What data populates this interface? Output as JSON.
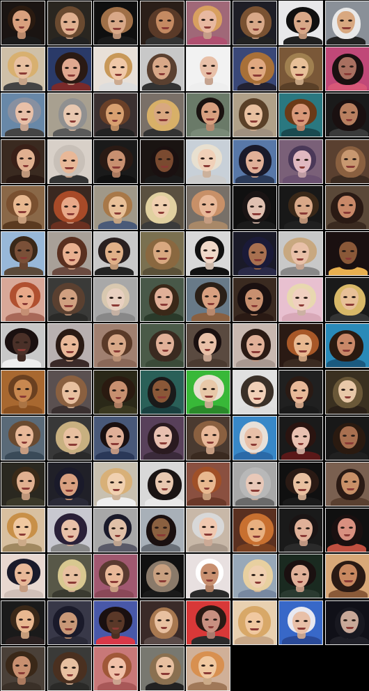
{
  "grid": {
    "columns": 8,
    "tiles": [
      {
        "bg": "#1a1412",
        "skin": "#d9a07e",
        "hair": "#2a1a10",
        "cloth": "#1a1a1a"
      },
      {
        "bg": "#2a2620",
        "skin": "#e0b090",
        "hair": "#6a4a30",
        "cloth": "#222"
      },
      {
        "bg": "#0f0f0f",
        "skin": "#d8a888",
        "hair": "#a07048",
        "cloth": "#1a1a1a"
      },
      {
        "bg": "#2a1e18",
        "skin": "#c48a62",
        "hair": "#5a3a28",
        "cloth": "#333"
      },
      {
        "bg": "#a06878",
        "skin": "#e8b8a0",
        "hair": "#d8a060",
        "cloth": "#b05070"
      },
      {
        "bg": "#1e1e26",
        "skin": "#d8a888",
        "hair": "#7a5232",
        "cloth": "#222"
      },
      {
        "bg": "#e8e8ea",
        "skin": "#d8a888",
        "hair": "#101010",
        "cloth": "#202020"
      },
      {
        "bg": "#8a9098",
        "skin": "#d8a880",
        "hair": "#e8e8e8",
        "cloth": "#222"
      },
      {
        "bg": "#cfc0a8",
        "skin": "#e8c0a0",
        "hair": "#d8b070",
        "cloth": "#444"
      },
      {
        "bg": "#2a3a68",
        "skin": "#e0a890",
        "hair": "#2a1a14",
        "cloth": "#7a2a2a"
      },
      {
        "bg": "#e8e0d8",
        "skin": "#f0c8a8",
        "hair": "#c89858",
        "cloth": "#ddd"
      },
      {
        "bg": "#c8c8c8",
        "skin": "#d8a888",
        "hair": "#5a4030",
        "cloth": "#333"
      },
      {
        "bg": "#f2f2f2",
        "skin": "#e8c0a8",
        "hair": "#f2f2f2",
        "cloth": "#eee"
      },
      {
        "bg": "#3a4878",
        "skin": "#e0a880",
        "hair": "#a87038",
        "cloth": "#223"
      },
      {
        "bg": "#7a5838",
        "skin": "#e8c098",
        "hair": "#a08050",
        "cloth": "#5a4028"
      },
      {
        "bg": "#c04878",
        "skin": "#a87060",
        "hair": "#1a1010",
        "cloth": "#d85878"
      },
      {
        "bg": "#6888a8",
        "skin": "#e8c0a8",
        "hair": "#8890a0",
        "cloth": "#444"
      },
      {
        "bg": "#a8a090",
        "skin": "#e8c8b0",
        "hair": "#909090",
        "cloth": "#5a5a5a"
      },
      {
        "bg": "#3a3030",
        "skin": "#d8a070",
        "hair": "#6a4028",
        "cloth": "#222"
      },
      {
        "bg": "#7a7068",
        "skin": "#d8a880",
        "hair": "#d8b068",
        "cloth": "#333"
      },
      {
        "bg": "#6a7a68",
        "skin": "#d8a080",
        "hair": "#1a1210",
        "cloth": "#7a8a78"
      },
      {
        "bg": "#b0a088",
        "skin": "#e8c0a0",
        "hair": "#5a4028",
        "cloth": "#a09080"
      },
      {
        "bg": "#2a7880",
        "skin": "#d89878",
        "hair": "#6a3a18",
        "cloth": "#1a4a50"
      },
      {
        "bg": "#1a1a1a",
        "skin": "#b88060",
        "hair": "#1a1010",
        "cloth": "#3a3a3a"
      },
      {
        "bg": "#3a2a20",
        "skin": "#e0b090",
        "hair": "#3a2018",
        "cloth": "#2a1a14"
      },
      {
        "bg": "#d8d0c8",
        "skin": "#e8b898",
        "hair": "#c8c0b8",
        "cloth": "#333"
      },
      {
        "bg": "#1a1a1a",
        "skin": "#c89070",
        "hair": "#2a1a14",
        "cloth": "#101010"
      },
      {
        "bg": "#1a1412",
        "skin": "#7a4a30",
        "hair": "#1a1010",
        "cloth": "#1a1a1a"
      },
      {
        "bg": "#c8d0d8",
        "skin": "#f0d0b8",
        "hair": "#e8e0d0",
        "cloth": "#ccc"
      },
      {
        "bg": "#5878a8",
        "skin": "#e0b098",
        "hair": "#1a1a2a",
        "cloth": "#2a3a58"
      },
      {
        "bg": "#7a6078",
        "skin": "#e0b8c0",
        "hair": "#4a3858",
        "cloth": "#6a5070"
      },
      {
        "bg": "#5a4030",
        "skin": "#c89870",
        "hair": "#8a6040",
        "cloth": "#3a2a20"
      },
      {
        "bg": "#8a6848",
        "skin": "#e8b890",
        "hair": "#7a5030",
        "cloth": "#5a3a20"
      },
      {
        "bg": "#3a2820",
        "skin": "#e8a888",
        "hair": "#a84a28",
        "cloth": "#6a3020"
      },
      {
        "bg": "#a09888",
        "skin": "#e8c098",
        "hair": "#a87848",
        "cloth": "#4a5a78"
      },
      {
        "bg": "#5a5040",
        "skin": "#f0d0b0",
        "hair": "#e0d0a0",
        "cloth": "#3a3a3a"
      },
      {
        "bg": "#787068",
        "skin": "#e8b898",
        "hair": "#c89068",
        "cloth": "#a88868"
      },
      {
        "bg": "#101010",
        "skin": "#e0c0b0",
        "hair": "#1a1414",
        "cloth": "#1a1a1a"
      },
      {
        "bg": "#181818",
        "skin": "#d8a888",
        "hair": "#3a2818",
        "cloth": "#202020"
      },
      {
        "bg": "#5a4838",
        "skin": "#c88868",
        "hair": "#2a1a14",
        "cloth": "#3a2a20"
      },
      {
        "bg": "#98b8d8",
        "skin": "#7a5038",
        "hair": "#3a2818",
        "cloth": "#5a4a3a"
      },
      {
        "bg": "#a8a098",
        "skin": "#e8b090",
        "hair": "#5a3020",
        "cloth": "#6a4a40"
      },
      {
        "bg": "#c8c8c8",
        "skin": "#e0b088",
        "hair": "#2a2020",
        "cloth": "#222"
      },
      {
        "bg": "#7a7050",
        "skin": "#d8a880",
        "hair": "#8a6840",
        "cloth": "#5a5038"
      },
      {
        "bg": "#d8d8d8",
        "skin": "#f0d8c8",
        "hair": "#101010",
        "cloth": "#111"
      },
      {
        "bg": "#1a1a28",
        "skin": "#a87050",
        "hair": "#1a1a38",
        "cloth": "#2a2a48"
      },
      {
        "bg": "#c8c8c8",
        "skin": "#e8c0a8",
        "hair": "#c8a880",
        "cloth": "#888"
      },
      {
        "bg": "#1a1010",
        "skin": "#8a5838",
        "hair": "#1a1010",
        "cloth": "#e8b050"
      },
      {
        "bg": "#d8a898",
        "skin": "#e8a888",
        "hair": "#b05030",
        "cloth": "#a86858"
      },
      {
        "bg": "#3a3a38",
        "skin": "#d0a080",
        "hair": "#5a4030",
        "cloth": "#2a2a28"
      },
      {
        "bg": "#a8a8a8",
        "skin": "#e8d0c0",
        "hair": "#d8c8b0",
        "cloth": "#888"
      },
      {
        "bg": "#485848",
        "skin": "#e0b098",
        "hair": "#3a2818",
        "cloth": "#2a3a2a"
      },
      {
        "bg": "#687a88",
        "skin": "#d8a080",
        "hair": "#2a2018",
        "cloth": "#8a6040"
      },
      {
        "bg": "#3a2a20",
        "skin": "#c89070",
        "hair": "#1a1010",
        "cloth": "#2a1a14"
      },
      {
        "bg": "#e8c0d0",
        "skin": "#f0d0c0",
        "hair": "#e8d8b0",
        "cloth": "#d8a8b8"
      },
      {
        "bg": "#1a1a1a",
        "skin": "#e8c098",
        "hair": "#d8b868",
        "cloth": "#333"
      },
      {
        "bg": "#c8c8c8",
        "skin": "#4a3028",
        "hair": "#1a1010",
        "cloth": "#eee"
      },
      {
        "bg": "#b8b0b0",
        "skin": "#e8b898",
        "hair": "#2a1a14",
        "cloth": "#3a2a28"
      },
      {
        "bg": "#a08070",
        "skin": "#d8a888",
        "hair": "#5a3a28",
        "cloth": "#8a6858"
      },
      {
        "bg": "#4a5a48",
        "skin": "#e0b098",
        "hair": "#3a2a20",
        "cloth": "#3a4a38"
      },
      {
        "bg": "#5a4a40",
        "skin": "#e8c0a8",
        "hair": "#1a1010",
        "cloth": "#4a3a30"
      },
      {
        "bg": "#c8b8b0",
        "skin": "#e0b098",
        "hair": "#2a1a14",
        "cloth": "#a89890"
      },
      {
        "bg": "#2a1a14",
        "skin": "#e8b890",
        "hair": "#a85828",
        "cloth": "#3a2a20"
      },
      {
        "bg": "#2a8ab8",
        "skin": "#c88868",
        "hair": "#2a1a10",
        "cloth": "#1a5a80"
      },
      {
        "bg": "#a86830",
        "skin": "#c88850",
        "hair": "#6a4020",
        "cloth": "#8a5020"
      },
      {
        "bg": "#5a5050",
        "skin": "#e8c0a0",
        "hair": "#8a6040",
        "cloth": "#3a3030"
      },
      {
        "bg": "#2a2818",
        "skin": "#c89070",
        "hair": "#2a1a10",
        "cloth": "#3a3820"
      },
      {
        "bg": "#2a6058",
        "skin": "#8a5838",
        "hair": "#1a1a1a",
        "cloth": "#1a4040"
      },
      {
        "bg": "#38b838",
        "skin": "#e8c8a8",
        "hair": "#e8e0d0",
        "cloth": "#2a8a2a"
      },
      {
        "bg": "#e0e0e0",
        "skin": "#f0d0b8",
        "hair": "#3a3028",
        "cloth": "#ddd"
      },
      {
        "bg": "#202020",
        "skin": "#e8b898",
        "hair": "#2a1a14",
        "cloth": "#1a1a1a"
      },
      {
        "bg": "#3a3020",
        "skin": "#e8c8a8",
        "hair": "#6a5838",
        "cloth": "#2a2018"
      },
      {
        "bg": "#5a6a78",
        "skin": "#e8b898",
        "hair": "#6a4a30",
        "cloth": "#3a4a58"
      },
      {
        "bg": "#383838",
        "skin": "#e8c0a0",
        "hair": "#c8b080",
        "cloth": "#2a2a2a"
      },
      {
        "bg": "#485878",
        "skin": "#e0b098",
        "hair": "#1a1010",
        "cloth": "#2a3858"
      },
      {
        "bg": "#58405a",
        "skin": "#e8c0b0",
        "hair": "#2a1a20",
        "cloth": "#3a2a3a"
      },
      {
        "bg": "#4a3a30",
        "skin": "#e8b898",
        "hair": "#8a6040",
        "cloth": "#3a2a20"
      },
      {
        "bg": "#3888c8",
        "skin": "#e8c0a8",
        "hair": "#e8e0d8",
        "cloth": "#2a6aa8"
      },
      {
        "bg": "#1a1a1a",
        "skin": "#e8c0b0",
        "hair": "#2a1410",
        "cloth": "#5a1818"
      },
      {
        "bg": "#181818",
        "skin": "#a87050",
        "hair": "#2a1a10",
        "cloth": "#202020"
      },
      {
        "bg": "#2a2820",
        "skin": "#e0b090",
        "hair": "#3a2a18",
        "cloth": "#3a3828"
      },
      {
        "bg": "#202028",
        "skin": "#d8a080",
        "hair": "#1a1a2a",
        "cloth": "#2a2a38"
      },
      {
        "bg": "#c8c0b0",
        "skin": "#f0d0b0",
        "hair": "#d8b078",
        "cloth": "#eee"
      },
      {
        "bg": "#d8d8d8",
        "skin": "#e8c8b0",
        "hair": "#1a1414",
        "cloth": "#e8e8e8"
      },
      {
        "bg": "#8a5040",
        "skin": "#e8b890",
        "hair": "#a05028",
        "cloth": "#6a3828"
      },
      {
        "bg": "#a8a8a8",
        "skin": "#e8c8b8",
        "hair": "#b8b8b8",
        "cloth": "#6a6a6a"
      },
      {
        "bg": "#101010",
        "skin": "#e8c0a0",
        "hair": "#2a1a14",
        "cloth": "#1a1a1a"
      },
      {
        "bg": "#7a6050",
        "skin": "#c89068",
        "hair": "#2a1a14",
        "cloth": "#5a4030"
      },
      {
        "bg": "#d8c0a0",
        "skin": "#f0c8a0",
        "hair": "#c89048",
        "cloth": "#a08860"
      },
      {
        "bg": "#c8c8d0",
        "skin": "#e8c0a8",
        "hair": "#2a2038",
        "cloth": "#888"
      },
      {
        "bg": "#a8a8a8",
        "skin": "#e0c0a8",
        "hair": "#1a1a2a",
        "cloth": "#5a5a68"
      },
      {
        "bg": "#a8b0b8",
        "skin": "#8a6040",
        "hair": "#1a1010",
        "cloth": "#6a7078"
      },
      {
        "bg": "#c8b8a8",
        "skin": "#f0c8b0",
        "hair": "#d8d8d8",
        "cloth": "#a8988a"
      },
      {
        "bg": "#5a3020",
        "skin": "#e8b080",
        "hair": "#c87030",
        "cloth": "#7a4020"
      },
      {
        "bg": "#1a1a1a",
        "skin": "#e0b098",
        "hair": "#1a1414",
        "cloth": "#2a2a2a"
      },
      {
        "bg": "#101010",
        "skin": "#d89080",
        "hair": "#1a1010",
        "cloth": "#c05040"
      },
      {
        "bg": "#e8d8d0",
        "skin": "#e8b898",
        "hair": "#1a1a2a",
        "cloth": "#d0c0b8"
      },
      {
        "bg": "#585848",
        "skin": "#e8c0a0",
        "hair": "#d8c890",
        "cloth": "#3a3a30"
      },
      {
        "bg": "#a05870",
        "skin": "#e8b898",
        "hair": "#5a3a30",
        "cloth": "#8a4858"
      },
      {
        "bg": "#101010",
        "skin": "#c8a080",
        "hair": "#8a7a6a",
        "cloth": "#1a1a1a"
      },
      {
        "bg": "#e8e0e0",
        "skin": "#c89070",
        "hair": "#ffffff",
        "cloth": "#2a2a2a"
      },
      {
        "bg": "#98a8b8",
        "skin": "#f0d0b0",
        "hair": "#e8d0a0",
        "cloth": "#7888a0"
      },
      {
        "bg": "#1a2a20",
        "skin": "#e0b098",
        "hair": "#1a1010",
        "cloth": "#2a3a30"
      },
      {
        "bg": "#d8a878",
        "skin": "#c88860",
        "hair": "#2a1a14",
        "cloth": "#8a5a38"
      },
      {
        "bg": "#1a1a1a",
        "skin": "#e8b890",
        "hair": "#3a2818",
        "cloth": "#2a2020"
      },
      {
        "bg": "#383848",
        "skin": "#c89878",
        "hair": "#1a1a2a",
        "cloth": "#2a2a38"
      },
      {
        "bg": "#4858a8",
        "skin": "#5a3828",
        "hair": "#1a1010",
        "cloth": "#d83848"
      },
      {
        "bg": "#3a2a28",
        "skin": "#e8c0a0",
        "hair": "#a87850",
        "cloth": "#5a4a48"
      },
      {
        "bg": "#d83838",
        "skin": "#c89080",
        "hair": "#2a1a14",
        "cloth": "#2a2a2a"
      },
      {
        "bg": "#e8d0b0",
        "skin": "#f0c8a0",
        "hair": "#d8a868",
        "cloth": "#c8a888"
      },
      {
        "bg": "#3868c8",
        "skin": "#e8c0a8",
        "hair": "#e8e8f0",
        "cloth": "#2a4a98"
      },
      {
        "bg": "#101018",
        "skin": "#c8a898",
        "hair": "#181820",
        "cloth": "#202028"
      },
      {
        "bg": "#4a4038",
        "skin": "#c89070",
        "hair": "#3a2818",
        "cloth": "#3a3028"
      },
      {
        "bg": "#3a3a38",
        "skin": "#e8c0a0",
        "hair": "#4a3020",
        "cloth": "#2a2a28"
      },
      {
        "bg": "#c87878",
        "skin": "#f0c0a8",
        "hair": "#a05838",
        "cloth": "#a85858"
      },
      {
        "bg": "#787870",
        "skin": "#e8c0a0",
        "hair": "#8a7050",
        "cloth": "#222"
      },
      {
        "bg": "#d0b098",
        "skin": "#f0c8a0",
        "hair": "#d89050",
        "cloth": "#a07858"
      }
    ]
  }
}
